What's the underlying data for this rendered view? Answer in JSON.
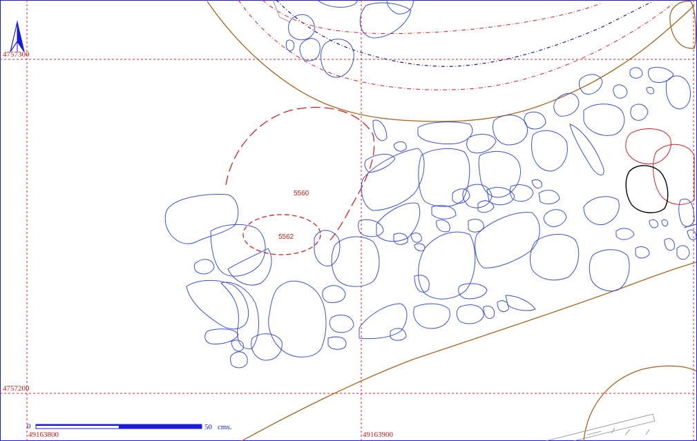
{
  "grid": {
    "y_labels": [
      "4757300",
      "4757200"
    ],
    "x_labels": [
      "49163800",
      "49163900"
    ]
  },
  "contexts": [
    {
      "id": "ctx-5560",
      "label": "5560"
    },
    {
      "id": "ctx-5562",
      "label": "5562"
    }
  ],
  "scale_bar": {
    "start_label": "0",
    "end_label": "50",
    "unit": "cms."
  },
  "colors": {
    "stones": "#3b4fd6",
    "grid": "#d42020",
    "contexts": "#d42020",
    "trench": "#a8621c",
    "frame": "#1a1ad8",
    "highlight_stone": "#000000"
  },
  "icons": {
    "north": "north-arrow-icon"
  }
}
